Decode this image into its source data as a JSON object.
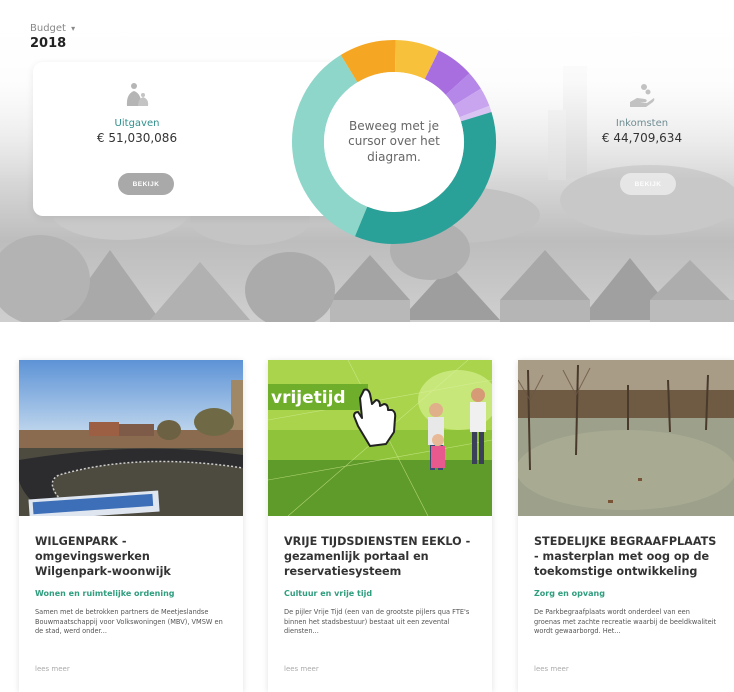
{
  "budget": {
    "label": "Budget",
    "year": "2018"
  },
  "uitgaven": {
    "label": "Uitgaven",
    "amount": "€ 51,030,086",
    "button": "BEKIJK"
  },
  "inkomsten": {
    "label": "Inkomsten",
    "amount": "€ 44,709,634",
    "button": "BEKIJK"
  },
  "donut": {
    "center_text": "Beweeg met je cursor over het diagram.",
    "segments": [
      {
        "value": 9,
        "color": "#f5a623"
      },
      {
        "value": 7,
        "color": "#f7c13c"
      },
      {
        "value": 6,
        "color": "#a86ee0"
      },
      {
        "value": 3,
        "color": "#b487e8"
      },
      {
        "value": 3,
        "color": "#c9a5ef"
      },
      {
        "value": 1,
        "color": "#d8c3f3"
      },
      {
        "value": 36,
        "color": "#2aa198"
      },
      {
        "value": 35,
        "color": "#8ed6c9"
      }
    ]
  },
  "cards": [
    {
      "title": "WILGENPARK - omgevingswerken Wilgenpark-woonwijk",
      "category": "Wonen en ruimtelijke ordening",
      "description": "Samen met de betrokken partners de Meetjeslandse Bouwmaatschappij voor Volkswoningen (MBV), VMSW en de stad, werd onder...",
      "more": "lees meer"
    },
    {
      "title": "VRIJE TIJDSDIENSTEN EEKLO - gezamenlijk portaal en reservatiesysteem",
      "category": "Cultuur en vrije tijd",
      "description": "De pijler Vrije Tijd (een van de grootste pijlers qua FTE's binnen het stadsbestuur) bestaat uit een zevental diensten...",
      "more": "lees meer",
      "image_text": "vrijetijd"
    },
    {
      "title": "STEDELIJKE BEGRAAFPLAATS - masterplan met oog op de toekomstige ontwikkeling",
      "category": "Zorg en opvang",
      "description": "De Parkbegraafplaats wordt onderdeel van een groenas met zachte recreatie waarbij de beeldkwaliteit wordt gewaarborgd. Het...",
      "more": "lees meer"
    }
  ]
}
